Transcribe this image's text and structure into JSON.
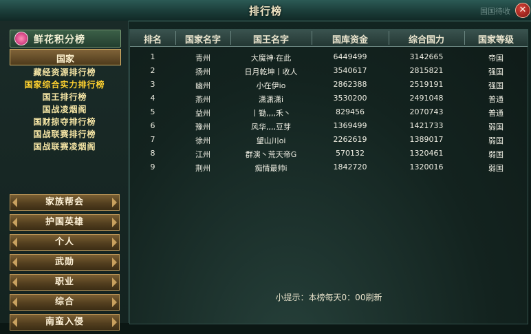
{
  "window": {
    "title": "排行榜",
    "title_right_text": "国国待收",
    "close_symbol": "✕"
  },
  "sidebar": {
    "header": "鲜花积分榜",
    "country_tab": "国家",
    "sub_items": [
      "藏经资源排行榜",
      "国家综合实力排行榜",
      "国王排行榜",
      "国战凌烟阁",
      "国财掠夺排行榜",
      "国战联赛排行榜",
      "国战联赛凌烟阁"
    ],
    "active_sub_index": 1,
    "buttons": [
      "家族帮会",
      "护国英雄",
      "个人",
      "武勋",
      "职业",
      "综合",
      "南蛮入侵"
    ]
  },
  "table": {
    "headers": [
      "排名",
      "国家名字",
      "国王名字",
      "国库资金",
      "综合国力",
      "国家等级"
    ],
    "rows": [
      [
        "1",
        "青州",
        "大魔神·在此",
        "6449499",
        "3142665",
        "帝国"
      ],
      [
        "2",
        "扬州",
        "日月乾坤丨收人",
        "3540617",
        "2815821",
        "强国"
      ],
      [
        "3",
        "幽州",
        "小在伊io",
        "2862388",
        "2519191",
        "强国"
      ],
      [
        "4",
        "燕州",
        "潇潇潇i",
        "3530200",
        "2491048",
        "普通"
      ],
      [
        "5",
        "益州",
        "丨锄,,,,禾丶",
        "829456",
        "2070743",
        "普通"
      ],
      [
        "6",
        "豫州",
        "风华,,,,豆芽",
        "1369499",
        "1421733",
        "弱国"
      ],
      [
        "7",
        "徐州",
        "望山川oi",
        "2262619",
        "1389017",
        "弱国"
      ],
      [
        "8",
        "江州",
        "群演丶荒天帝G",
        "570132",
        "1320461",
        "弱国"
      ],
      [
        "9",
        "荆州",
        "痴情最帅i",
        "1842720",
        "1320016",
        "弱国"
      ]
    ]
  },
  "tip": "小提示：本榜每天0：00刷新"
}
